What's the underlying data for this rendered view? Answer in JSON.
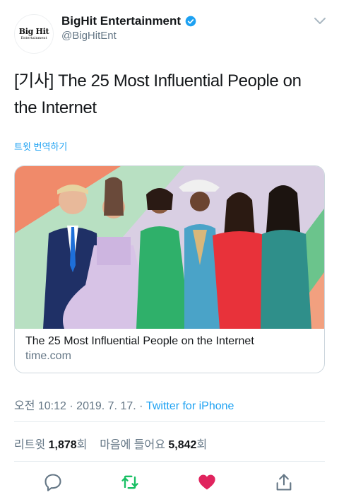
{
  "account": {
    "display_name": "BigHit Entertainment",
    "handle": "@BigHitEnt",
    "logo_text": "Big Hit",
    "logo_subtext": "Entertainment",
    "verified_color": "#1da1f2"
  },
  "tweet": {
    "text": "[기사] The 25 Most Influential People on the Internet",
    "translate_label": "트윗 번역하기"
  },
  "card": {
    "title": "The 25 Most Influential People on the Internet",
    "domain": "time.com"
  },
  "meta": {
    "time": "오전 10:12",
    "date": "2019. 7. 17.",
    "source": "Twitter for iPhone"
  },
  "stats": {
    "retweets_label": "리트윗",
    "retweets_count": "1,878",
    "retweets_unit": "회",
    "likes_label": "마음에 들어요",
    "likes_count": "5,842",
    "likes_unit": "회"
  },
  "actions": [
    {
      "icon": "reply-icon"
    },
    {
      "icon": "retweet-icon",
      "color": "#17bf63"
    },
    {
      "icon": "like-icon",
      "color": "#e0245e"
    },
    {
      "icon": "share-icon"
    }
  ]
}
